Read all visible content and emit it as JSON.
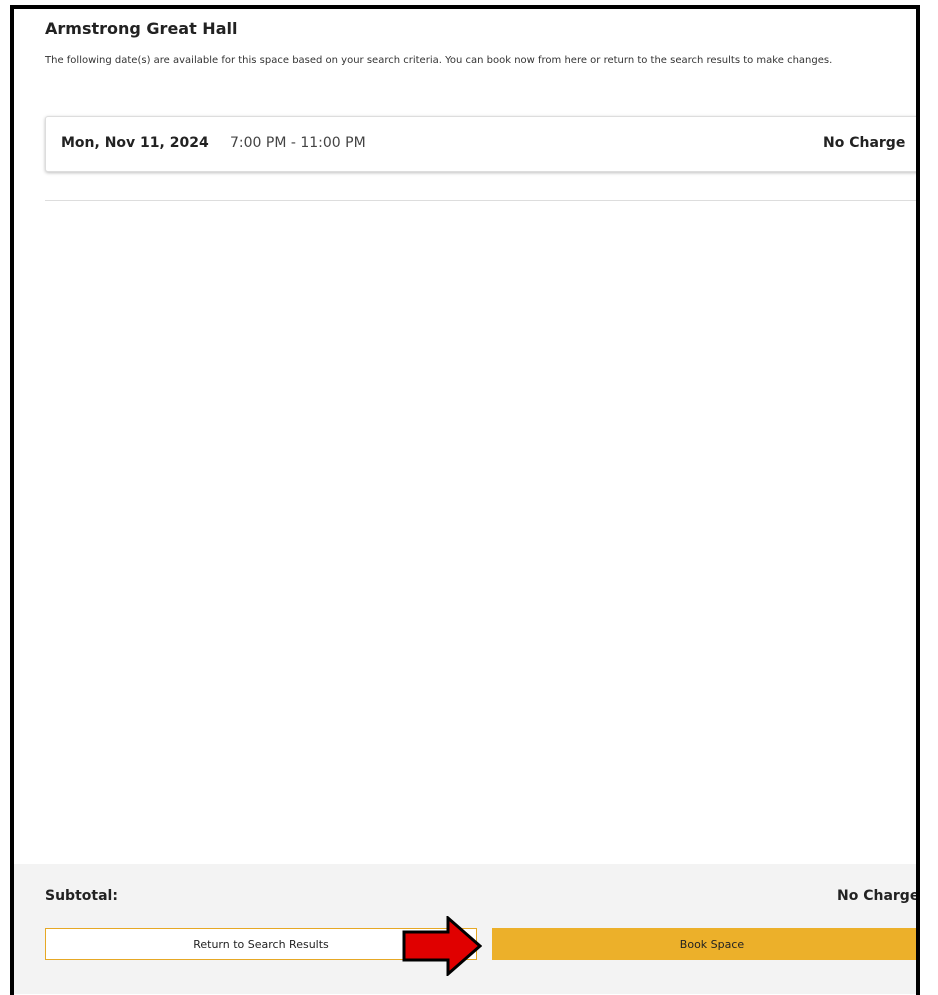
{
  "space": {
    "title": "Armstrong Great Hall",
    "description": "The following date(s) are available for this space based on your search criteria. You can book now from here or return to the search results to make changes."
  },
  "booking": {
    "date": "Mon, Nov 11, 2024",
    "time": "7:00 PM - 11:00 PM",
    "charge": "No Charge"
  },
  "footer": {
    "subtotal_label": "Subtotal:",
    "subtotal_value": "No Charge",
    "return_label": "Return to Search Results",
    "book_label": "Book Space"
  },
  "colors": {
    "accent": "#ecb02a",
    "arrow": "#e00000"
  },
  "annotations": {
    "arrow_icon": "red-arrow-right-icon"
  }
}
